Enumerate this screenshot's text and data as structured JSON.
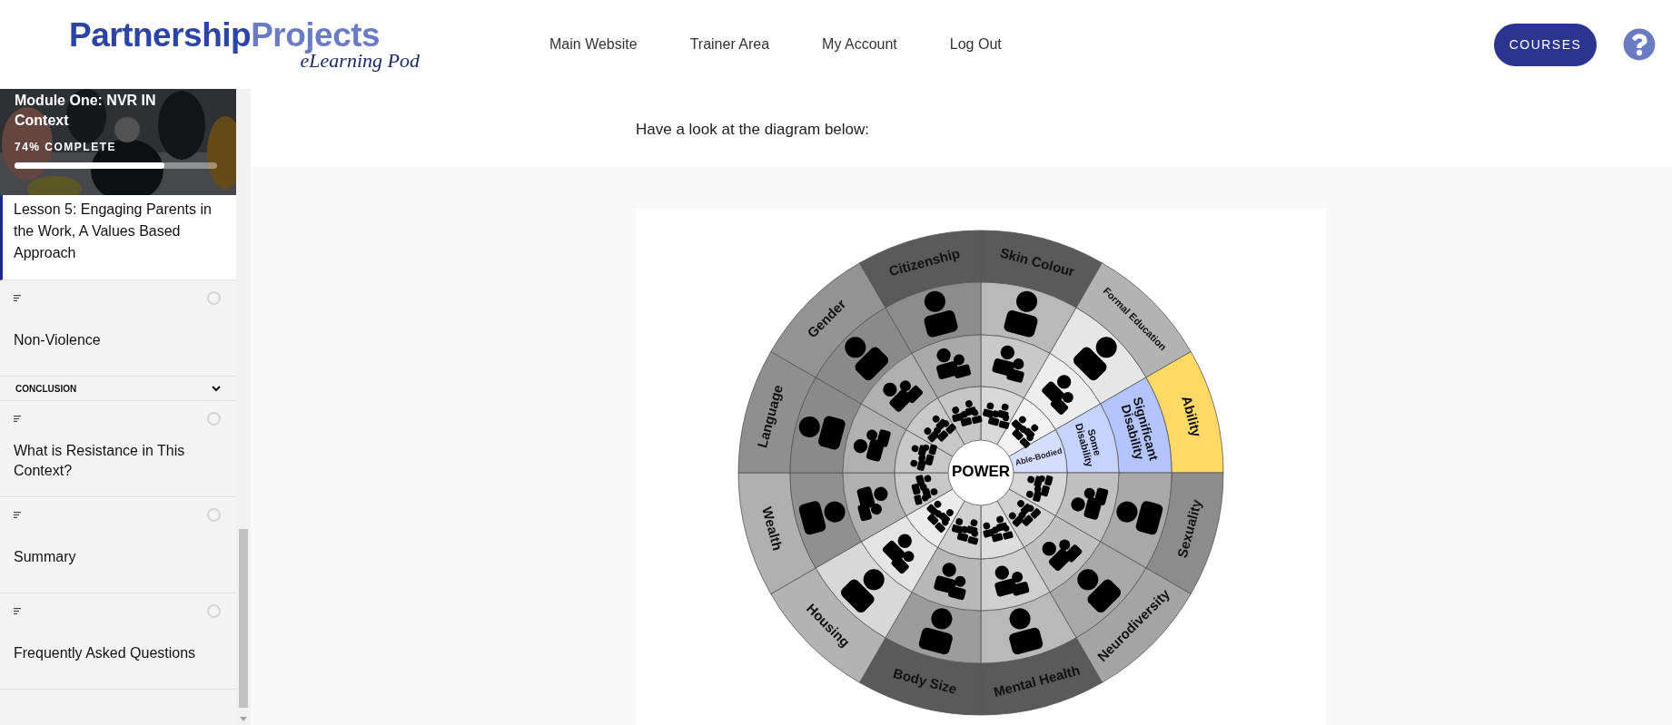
{
  "header": {
    "logo": {
      "word_1": "Partnership",
      "word_2": "Projects",
      "tagline": "eLearning Pod"
    },
    "nav": [
      {
        "label": "Main Website"
      },
      {
        "label": "Trainer Area"
      },
      {
        "label": "My Account"
      },
      {
        "label": "Log Out"
      }
    ],
    "courses_button": "COURSES"
  },
  "sidebar": {
    "module": {
      "kind": "picture",
      "title": "Module One: NVR IN Context",
      "progress": "74% COMPLETE",
      "level": 0.74
    },
    "lesson": {
      "title": "Lesson 5: Engaging Parents in the Work, A Values Based Approach",
      "selected": true
    },
    "topics": [
      {
        "title": "Non-Violence",
        "completed": false
      }
    ],
    "sections": [
      {
        "title": "CONCLUSION",
        "expanded": true,
        "topics": [
          {
            "title": "What is Resistance in This Context?",
            "completed": false
          },
          {
            "title": "Summary",
            "completed": false
          },
          {
            "title": "Frequently Asked Questions",
            "completed": false
          }
        ]
      }
    ]
  },
  "main": {
    "intro": "Have a look at the diagram below:",
    "diagram": {
      "center": "POWER",
      "sectors": [
        {
          "label": "Skin Colour",
          "kind": "icons",
          "highlighted": false
        },
        {
          "label": "Formal Education",
          "kind": "icons",
          "highlighted": false
        },
        {
          "label": "Ability",
          "kind": "rings",
          "highlighted": true,
          "ring_labels": [
            "Able-Bodied",
            "Some Disability",
            "Significant Disability"
          ]
        },
        {
          "label": "Sexuality",
          "kind": "icons",
          "highlighted": false
        },
        {
          "label": "Neurodiversity",
          "kind": "icons",
          "highlighted": false
        },
        {
          "label": "Mental Health",
          "kind": "icons",
          "highlighted": false
        },
        {
          "label": "Body Size",
          "kind": "icons",
          "highlighted": false
        },
        {
          "label": "Housing",
          "kind": "icons",
          "highlighted": false
        },
        {
          "label": "Wealth",
          "kind": "icons",
          "highlighted": false
        },
        {
          "label": "Language",
          "kind": "icons",
          "highlighted": false
        },
        {
          "label": "Gender",
          "kind": "icons",
          "highlighted": false
        },
        {
          "label": "Citizenship",
          "kind": "icons",
          "highlighted": false
        }
      ]
    }
  }
}
